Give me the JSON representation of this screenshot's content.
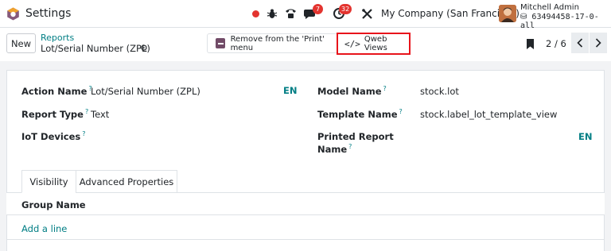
{
  "navbar": {
    "app_title": "Settings",
    "activity_badge": "7",
    "clock_badge": "32",
    "company": "My Company (San Francisco)",
    "user_name": "Mitchell Admin",
    "db_name": "63494458-17-0-all",
    "icons": [
      "record-dot-icon",
      "bug-icon",
      "phone-icon",
      "chat-icon",
      "clock-icon",
      "tools-icon",
      "database-icon"
    ]
  },
  "controlbar": {
    "new_label": "New",
    "breadcrumb_parent": "Reports",
    "breadcrumb_current": "Lot/Serial Number (ZPL)",
    "remove_print_label": "Remove from the 'Print' menu",
    "qweb_views_label": "Qweb Views",
    "pager_value": "2 / 6"
  },
  "form": {
    "action_name_label": "Action Name",
    "action_name_value": "Lot/Serial Number (ZPL)",
    "action_name_lang": "EN",
    "report_type_label": "Report Type",
    "report_type_value": "Text",
    "iot_devices_label": "IoT Devices",
    "model_name_label": "Model Name",
    "model_name_value": "stock.lot",
    "template_name_label": "Template Name",
    "template_name_value": "stock.label_lot_template_view",
    "printed_report_name_label_1": "Printed Report",
    "printed_report_name_label_2": "Name",
    "printed_report_name_lang": "EN",
    "help_mark": "?"
  },
  "tabs": [
    {
      "label": "Visibility",
      "active": true
    },
    {
      "label": "Advanced Properties",
      "active": false
    }
  ],
  "groups_table": {
    "header": "Group Name",
    "add_line_label": "Add a line"
  },
  "colors": {
    "accent_teal": "#017e84",
    "brand_purple": "#714b67",
    "highlight_red": "#e8141b",
    "badge_red": "#e3342f"
  }
}
